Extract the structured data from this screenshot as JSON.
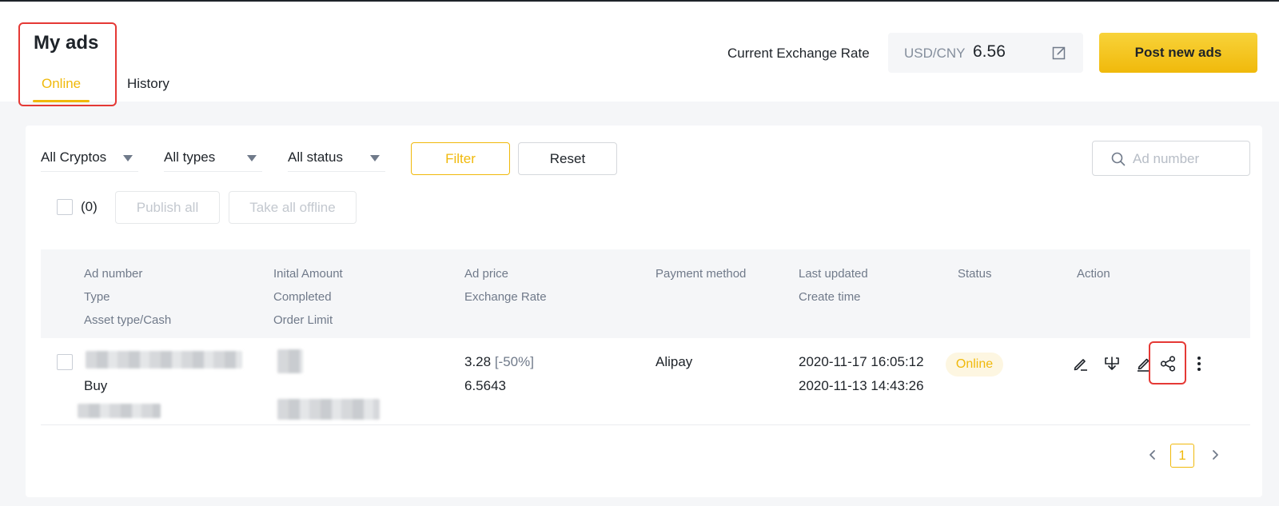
{
  "header": {
    "title": "My ads",
    "tabs": [
      {
        "label": "Online",
        "active": true
      },
      {
        "label": "History",
        "active": false
      }
    ],
    "exchange_rate_label": "Current Exchange Rate",
    "exchange_rate_pair": "USD/CNY",
    "exchange_rate_value": "6.56",
    "post_button_label": "Post new ads"
  },
  "filters": {
    "crypto": "All Cryptos",
    "type": "All types",
    "status": "All status",
    "filter_label": "Filter",
    "reset_label": "Reset",
    "search_placeholder": "Ad number"
  },
  "bulk": {
    "count": "(0)",
    "publish_all_label": "Publish all",
    "take_offline_label": "Take all offline"
  },
  "table": {
    "columns": {
      "ad_number": "Ad number",
      "type": "Type",
      "asset_type": "Asset type/Cash",
      "initial_amount": "Inital Amount",
      "completed": "Completed",
      "order_limit": "Order Limit",
      "ad_price": "Ad price",
      "exchange_rate": "Exchange Rate",
      "payment_method": "Payment method",
      "last_updated": "Last updated",
      "create_time": "Create time",
      "status": "Status",
      "action": "Action"
    },
    "rows": [
      {
        "type": "Buy",
        "price": "3.28",
        "price_delta": "[-50%]",
        "exchange_rate": "6.5643",
        "payment_method": "Alipay",
        "last_updated": "2020-11-17 16:05:12",
        "create_time": "2020-11-13 14:43:26",
        "status": "Online",
        "actions": [
          "edit-pen-icon",
          "download-icon",
          "pencil-icon",
          "share-icon",
          "more-vertical-icon"
        ]
      }
    ]
  },
  "pagination": {
    "current_page": "1"
  },
  "colors": {
    "accent": "#f0b90b",
    "highlight": "#e53935",
    "text": "#1e2329",
    "muted": "#707a8a"
  }
}
